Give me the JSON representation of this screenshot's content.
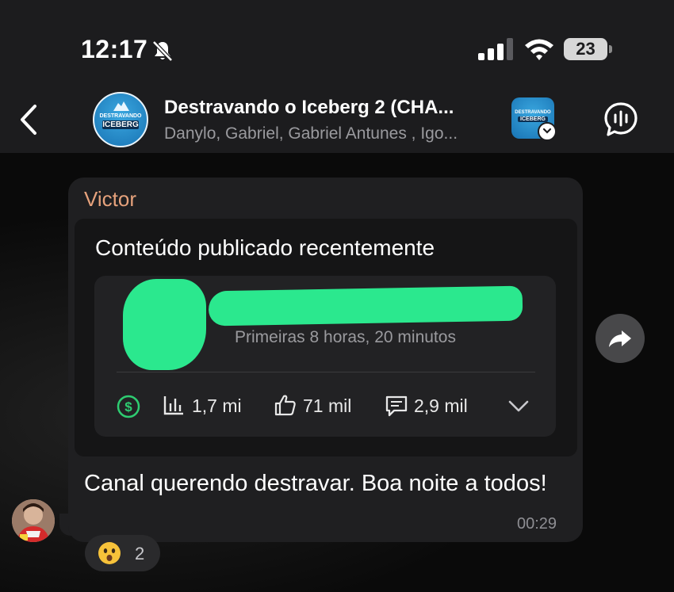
{
  "status_bar": {
    "time": "12:17",
    "battery": "23"
  },
  "header": {
    "title": "Destravando o Iceberg 2 (CHA...",
    "subtitle": "Danylo, Gabriel, Gabriel Antunes , Igo...",
    "group_avatar_line1": "DESTRAVANDO",
    "group_avatar_line2": "ICEBERG",
    "channel_avatar_line1": "DESTRAVANDO",
    "channel_avatar_line2": "ICEBERG"
  },
  "message": {
    "sender": "Victor",
    "card_title": "Conteúdo publicado recentemente",
    "video_meta": "Primeiras 8 horas, 20 minutos",
    "views": "1,7 mi",
    "likes": "71 mil",
    "comments": "2,9 mil",
    "text": "Canal querendo destravar. Boa noite a todos!",
    "time": "00:29",
    "reaction": {
      "emoji": "surprised-face",
      "count": "2"
    }
  },
  "colors": {
    "accent_green": "#2be88e",
    "sender_name": "#e6a27c",
    "dollar_icon": "#2ecc71",
    "bubble_bg": "#1f1f21"
  }
}
